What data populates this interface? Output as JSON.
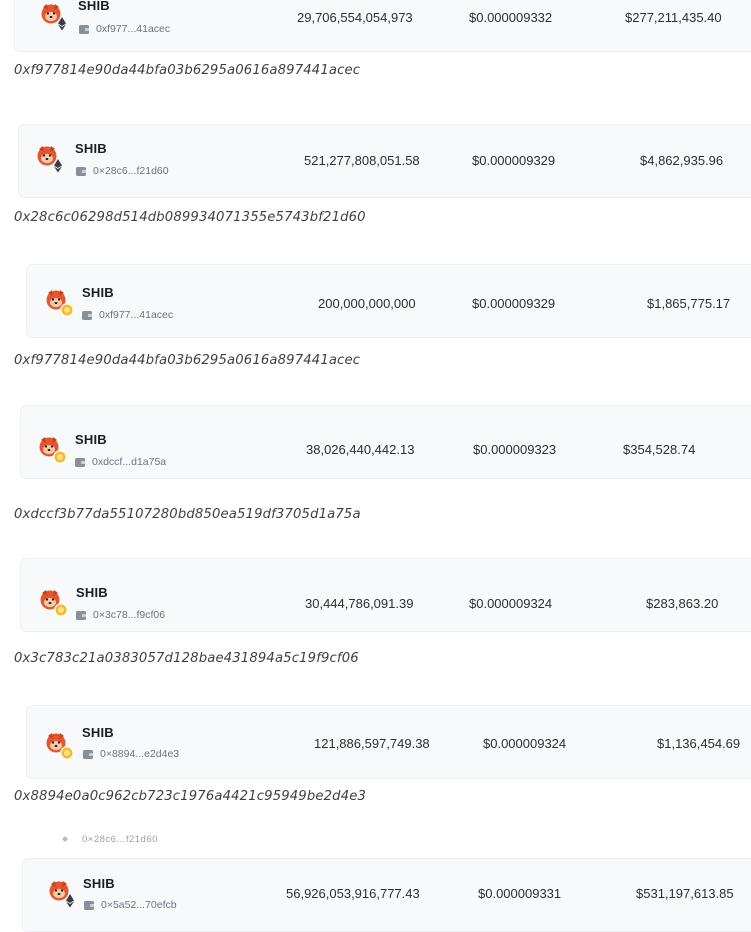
{
  "rows": [
    {
      "symbol": "SHIB",
      "badge": "eth",
      "addr_short": "0xf977...41acec",
      "amount": "29,706,554,054,973",
      "price": "$0.000009332",
      "value": "$277,211,435.40",
      "full_address": "0xf977814e90da44bfa03b6295a0616a897441acec"
    },
    {
      "symbol": "SHIB",
      "badge": "eth",
      "addr_short": "0×28c6...f21d60",
      "amount": "521,277,808,051.58",
      "price": "$0.000009329",
      "value": "$4,862,935.96",
      "full_address": "0x28c6c06298d514db089934071355e5743bf21d60"
    },
    {
      "symbol": "SHIB",
      "badge": "coin",
      "addr_short": "0xf977...41acec",
      "amount": "200,000,000,000",
      "price": "$0.000009329",
      "value": "$1,865,775.17",
      "full_address": "0xf977814e90da44bfa03b6295a0616a897441acec"
    },
    {
      "symbol": "SHIB",
      "badge": "coin",
      "addr_short": "0xdccf...d1a75a",
      "amount": "38,026,440,442.13",
      "price": "$0.000009323",
      "value": "$354,528.74",
      "full_address": "0xdccf3b77da55107280bd850ea519df3705d1a75a"
    },
    {
      "symbol": "SHIB",
      "badge": "coin",
      "addr_short": "0×3c78...f9cf06",
      "amount": "30,444,786,091.39",
      "price": "$0.000009324",
      "value": "$283,863.20",
      "full_address": "0x3c783c21a0383057d128bae431894a5c19f9cf06"
    },
    {
      "symbol": "SHIB",
      "badge": "coin",
      "addr_short": "0×8894...e2d4e3",
      "amount": "121,886,597,749.38",
      "price": "$0.000009324",
      "value": "$1,136,454.69",
      "full_address": "0x8894e0a0c962cb723c1976a4421c95949be2d4e3"
    },
    {
      "symbol": "SHIB",
      "badge": "eth",
      "addr_short": "0×5a52...70efcb",
      "amount": "56,926,053,916,777.43",
      "price": "$0.000009331",
      "value": "$531,197,613.85",
      "full_address": ""
    }
  ],
  "ghost_text": "0×28c6...f21d60",
  "colors": {
    "shib_orange": "#e4572e",
    "coin_yellow": "#f5b82e",
    "eth_dark": "#3a3d43"
  }
}
